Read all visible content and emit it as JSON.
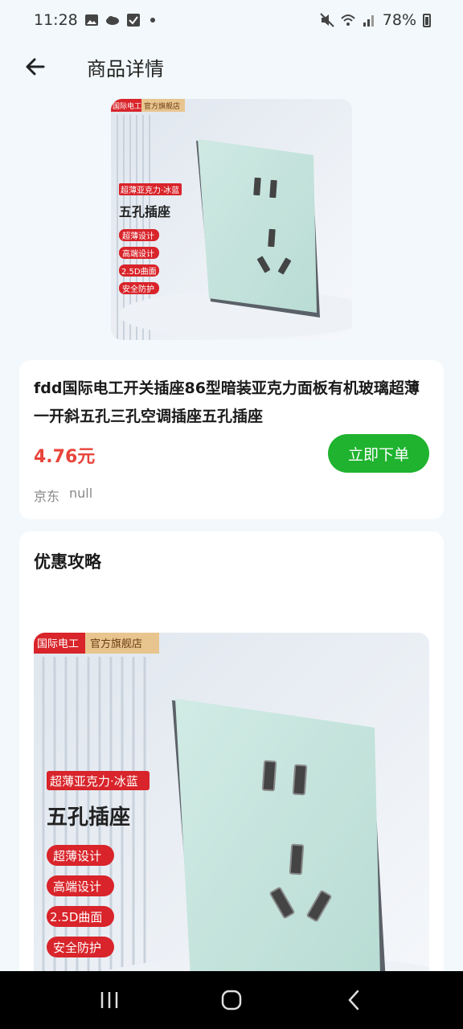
{
  "status_bar": {
    "time": "11:28",
    "battery": "78%",
    "icons": [
      "gallery-icon",
      "cloud-icon",
      "check-box-icon",
      "dot-icon",
      "mute-icon",
      "wifi-icon",
      "signal-icon",
      "battery-icon"
    ]
  },
  "app_bar": {
    "title": "商品详情",
    "back_icon": "arrow-left-icon"
  },
  "product": {
    "title": "fdd国际电工开关插座86型暗装亚克力面板有机玻璃超薄一开斜五孔三孔空调插座五孔插座",
    "price": "4.76元",
    "buy_label": "立即下单",
    "platform": "京东",
    "shop": "null"
  },
  "product_image": {
    "brand_tag": "国际电工",
    "store_tag": "官方旗舰店",
    "color_label": "超薄亚克力·冰蓝",
    "name": "五孔插座",
    "features": [
      "超薄设计",
      "高端设计",
      "2.5D曲面",
      "安全防护"
    ]
  },
  "promo": {
    "title": "优惠攻略"
  },
  "nav": {
    "icons": [
      "recent-apps-icon",
      "home-icon",
      "back-icon"
    ]
  },
  "colors": {
    "background": "#f2f8fb",
    "price": "#e8453c",
    "buy_button": "#1fb32f",
    "panel": "#c9e4de"
  }
}
